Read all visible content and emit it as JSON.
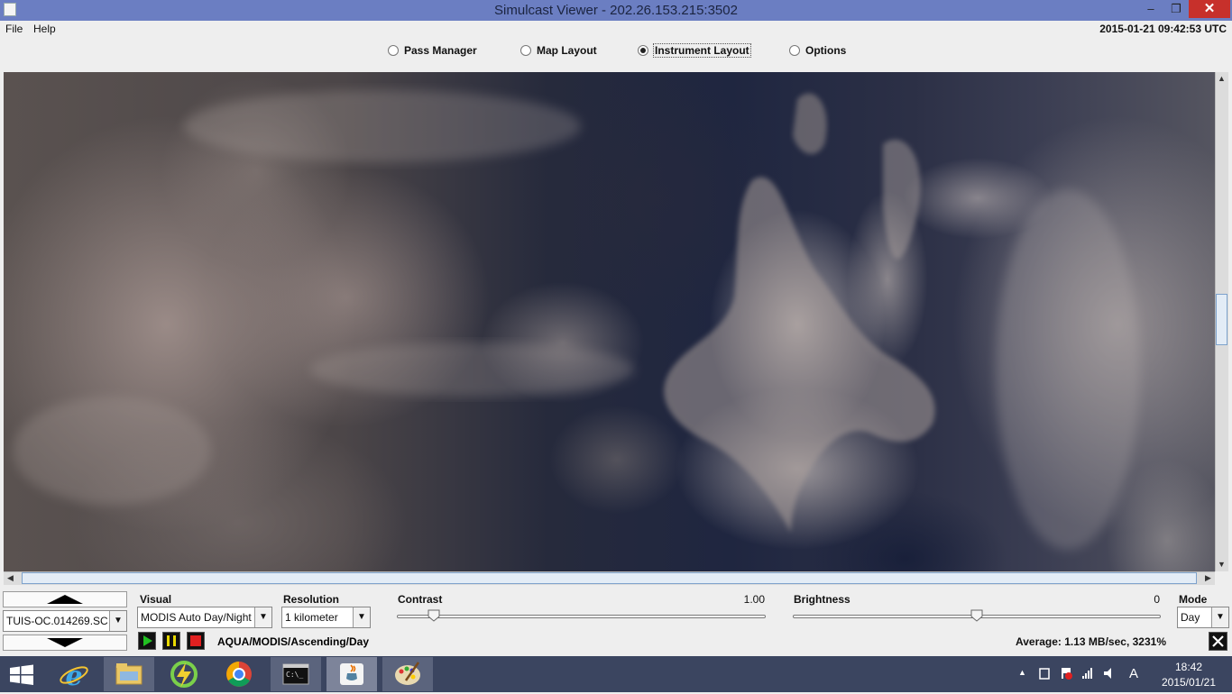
{
  "window": {
    "title": "Simulcast Viewer - 202.26.153.215:3502",
    "minimize_glyph": "–",
    "maximize_glyph": "❐",
    "close_glyph": "✕"
  },
  "menu": {
    "file": "File",
    "help": "Help",
    "utc_clock": "2015-01-21 09:42:53 UTC"
  },
  "tabs": [
    {
      "label": "Pass Manager",
      "selected": false
    },
    {
      "label": "Map Layout",
      "selected": false
    },
    {
      "label": "Instrument Layout",
      "selected": true
    },
    {
      "label": "Options",
      "selected": false
    }
  ],
  "scrollbars": {
    "vertical_thumb_start": 0.44,
    "vertical_thumb_fraction": 0.11,
    "horizontal_thumb_start": 0.0,
    "horizontal_thumb_fraction": 1.0
  },
  "controls": {
    "pass_file": "TUIS-OC.014269.SC",
    "visual_label": "Visual",
    "visual_value": "MODIS Auto Day/Night",
    "resolution_label": "Resolution",
    "resolution_value": "1 kilometer",
    "contrast_label": "Contrast",
    "contrast_value": "1.00",
    "contrast_level": 0.1,
    "brightness_label": "Brightness",
    "brightness_value": "0",
    "brightness_level": 0.5,
    "mode_label": "Mode",
    "mode_value": "Day",
    "pass_info": "AQUA/MODIS/Ascending/Day",
    "average": "Average: 1.13 MB/sec, 3231%",
    "play_color": "#22c022",
    "pause_color": "#e8d800",
    "stop_color": "#e02020"
  },
  "taskbar": {
    "apps": [
      "start-button",
      "internet-explorer",
      "file-explorer",
      "sync-app",
      "chrome",
      "command-prompt",
      "java",
      "paint"
    ],
    "ime": "A",
    "time": "18:42",
    "date": "2015/01/21"
  }
}
